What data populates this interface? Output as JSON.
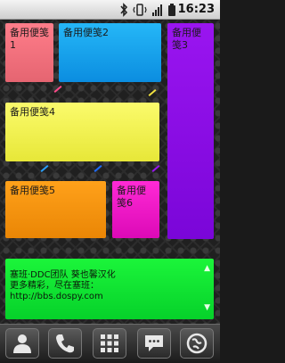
{
  "status_bar": {
    "time": "16:23",
    "icons": [
      "bluetooth-icon",
      "vibrate-icon",
      "signal-icon",
      "battery-icon"
    ]
  },
  "notes": [
    {
      "title": "备用便笺1",
      "color": "#ff7d8a"
    },
    {
      "title": "备用便笺2",
      "color": "#25b7f7"
    },
    {
      "title": "备用便笺3",
      "color": "#9a15f0"
    },
    {
      "title": "备用便笺4",
      "color": "#fbfb6c"
    },
    {
      "title": "备用便笺5",
      "color": "#ffa11a"
    },
    {
      "title": "备用便笺6",
      "color": "#ff2ad5"
    }
  ],
  "info_panel": {
    "line1": "塞班·DDC团队 葵也馨汉化",
    "line2": "更多精彩，尽在塞班：",
    "line3": "http://bbs.dospy.com",
    "color": "#1bf53a"
  },
  "dock": {
    "items": [
      "contacts-icon",
      "phone-icon",
      "app-drawer-icon",
      "messaging-icon",
      "browser-icon"
    ]
  }
}
